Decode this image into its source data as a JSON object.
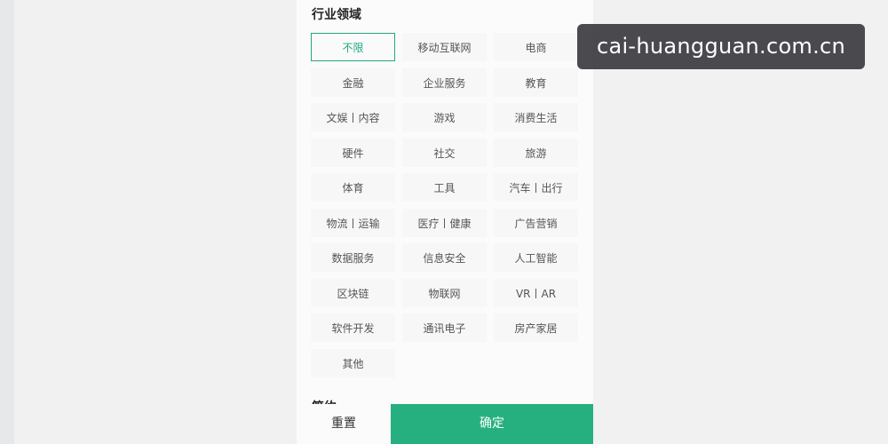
{
  "filter": {
    "section_title": "行业领域",
    "options": [
      {
        "label": "不限",
        "selected": true
      },
      {
        "label": "移动互联网",
        "selected": false
      },
      {
        "label": "电商",
        "selected": false
      },
      {
        "label": "金融",
        "selected": false
      },
      {
        "label": "企业服务",
        "selected": false
      },
      {
        "label": "教育",
        "selected": false
      },
      {
        "label": "文娱丨内容",
        "selected": false
      },
      {
        "label": "游戏",
        "selected": false
      },
      {
        "label": "消费生活",
        "selected": false
      },
      {
        "label": "硬件",
        "selected": false
      },
      {
        "label": "社交",
        "selected": false
      },
      {
        "label": "旅游",
        "selected": false
      },
      {
        "label": "体育",
        "selected": false
      },
      {
        "label": "工具",
        "selected": false
      },
      {
        "label": "汽车丨出行",
        "selected": false
      },
      {
        "label": "物流丨运输",
        "selected": false
      },
      {
        "label": "医疗丨健康",
        "selected": false
      },
      {
        "label": "广告营销",
        "selected": false
      },
      {
        "label": "数据服务",
        "selected": false
      },
      {
        "label": "信息安全",
        "selected": false
      },
      {
        "label": "人工智能",
        "selected": false
      },
      {
        "label": "区块链",
        "selected": false
      },
      {
        "label": "物联网",
        "selected": false
      },
      {
        "label": "VR丨AR",
        "selected": false
      },
      {
        "label": "软件开发",
        "selected": false
      },
      {
        "label": "通讯电子",
        "selected": false
      },
      {
        "label": "房产家居",
        "selected": false
      },
      {
        "label": "其他",
        "selected": false
      }
    ],
    "next_section_title": "简约"
  },
  "footer": {
    "reset_label": "重置",
    "confirm_label": "确定"
  },
  "watermark": {
    "text": "cai-huangguan.com.cn"
  },
  "colors": {
    "accent": "#27b07f",
    "selected_border": "#27a582"
  }
}
